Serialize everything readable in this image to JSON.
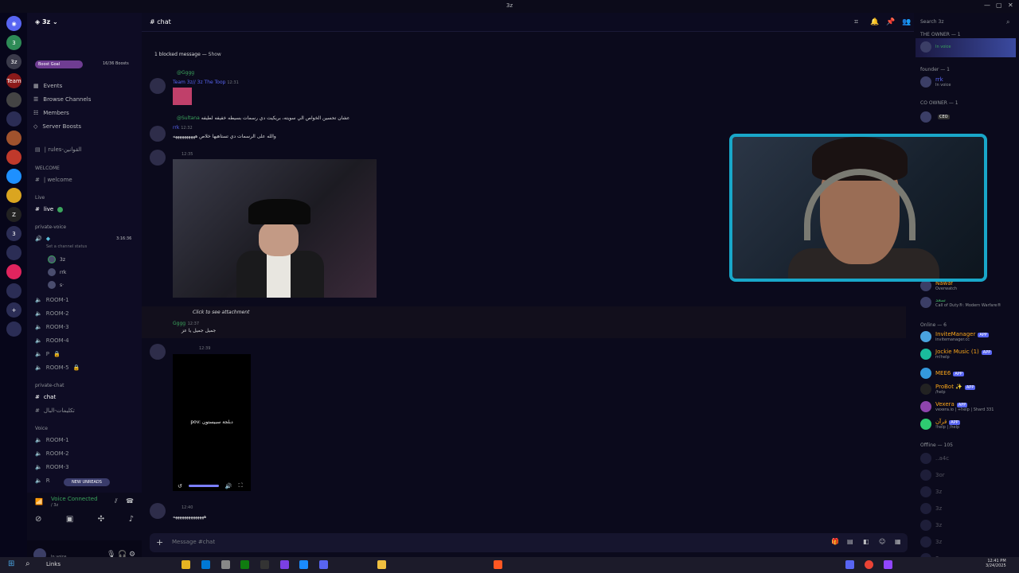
{
  "window": {
    "title": "3z",
    "controls": [
      "—",
      "▢",
      "✕"
    ]
  },
  "servers": [
    {
      "label": "3",
      "color": "#2e8b57"
    },
    {
      "label": "3z",
      "color": "#3a3a4a"
    },
    {
      "label": "Team",
      "color": "#8b1a1a"
    },
    {
      "label": "",
      "color": "#444"
    },
    {
      "label": "",
      "color": "#2b2d55"
    },
    {
      "label": "",
      "color": "#a0522d"
    },
    {
      "label": "",
      "color": "#c0392b"
    },
    {
      "label": "",
      "color": "#1e90ff"
    },
    {
      "label": "",
      "color": "#daa520"
    },
    {
      "label": "Z",
      "color": "#222"
    },
    {
      "label": "3",
      "color": "#2b2d55"
    },
    {
      "label": "",
      "color": "#2b2d55"
    },
    {
      "label": "",
      "color": "#e0245e"
    },
    {
      "label": "",
      "color": "#2b2d55"
    },
    {
      "label": "+",
      "color": "#2b2d55"
    },
    {
      "label": "",
      "color": "#2b2d55"
    }
  ],
  "sidebar": {
    "server_name": "3z",
    "boost_goal": "Boost Goal",
    "boost_count": "16/36 Boosts",
    "nav": [
      "Events",
      "Browse Channels",
      "Members",
      "Server Boosts"
    ],
    "rules_channel": "| rules-القوانين",
    "categories": {
      "welcome": "WELCOME",
      "live": "Live",
      "private_voice": "private-voice",
      "private_chat": "private-chat",
      "voice": "Voice"
    },
    "welcome_channel": "| welcome",
    "live_channel": "live",
    "voice_timer": "3:16:36",
    "status_hint": "Set a channel status",
    "voice_users": [
      "3z",
      "rrk",
      "s·"
    ],
    "rooms": [
      "ROOM-1",
      "ROOM-2",
      "ROOM-3",
      "ROOM-4",
      "P",
      "ROOM-5"
    ],
    "chat_channel": "chat",
    "chat_channel2": "تكليمات-البال",
    "voice_rooms": [
      "ROOM-1",
      "ROOM-2",
      "ROOM-3",
      "R"
    ],
    "new_unreads": "NEW UNREADS",
    "voice_connected": "Voice Connected",
    "voice_sub": "/ 3z",
    "user_status": "In voice"
  },
  "chat": {
    "channel": "chat",
    "blocked": "1 blocked message —",
    "show": "Show",
    "messages": [
      {
        "reply": "@Gggg",
        "user": "Team 3z// 3z The Toop",
        "time": "12:31"
      },
      {
        "reply": "@Sultana",
        "reply_text": "عشان تحسين الخواص الي سويته، بريكيت دي رسمات بسيطه خفيفه لطيفه",
        "user": "rrk",
        "time": "12:32",
        "text": "والله على الرسمات دي تستاهيها خلاص ههههههههههه"
      },
      {
        "time": "12:35"
      },
      {
        "attach": "Click to see attachment",
        "user": "Gggg",
        "time": "12:37",
        "text": "جميل جميل يا عز"
      },
      {
        "time": "12:39",
        "video_caption": "pov: دبلجة سبيستون"
      },
      {
        "time": "12:40",
        "text": "ههههههههههههههه"
      }
    ],
    "composer_placeholder": "Message #chat"
  },
  "members": {
    "search": "Search 3z",
    "groups": [
      {
        "title": "THE OWNER — 1",
        "members": [
          {
            "name": "",
            "status": "In voice"
          }
        ]
      },
      {
        "title": "founder — 1",
        "members": [
          {
            "name": "rrk",
            "status": "In voice"
          }
        ]
      },
      {
        "title": "CO OWNER — 1",
        "members": [
          {
            "name": "CEO",
            "status": ""
          }
        ]
      }
    ],
    "activity": [
      {
        "name": "Nawaf",
        "status": "Overwatch"
      },
      {
        "name": "سعد",
        "status": "Call of Duty®: Modern Warfare®"
      }
    ],
    "online_title": "Online — 6",
    "bots": [
      {
        "name": "InviteManager",
        "status": "invitemanager.cc"
      },
      {
        "name": "Jockie Music (1)",
        "status": "m!help"
      },
      {
        "name": "MEE6",
        "status": ""
      },
      {
        "name": "ProBot ✨",
        "status": "/help"
      },
      {
        "name": "Vexera",
        "status": "vexera.io | +help | Shard 331"
      },
      {
        "name": "قرآن",
        "status": "!help | /help"
      }
    ],
    "app_badge": "APP",
    "offline_title": "Offline — 105",
    "offline": [
      "..a4c",
      "3or",
      "3z",
      "3z",
      "3z",
      "3z",
      "3z",
      "3z"
    ]
  },
  "taskbar": {
    "links": "Links",
    "time": "12:41 PM",
    "date": "3/24/2025"
  }
}
